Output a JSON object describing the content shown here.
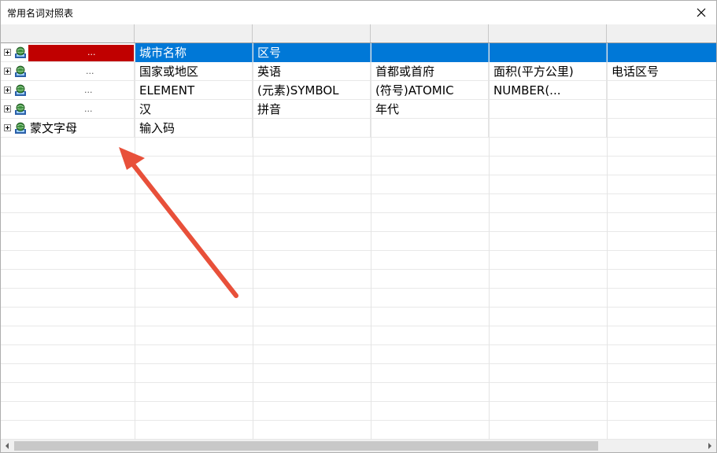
{
  "window": {
    "title": "常用名词对照表"
  },
  "columns": [
    "",
    "",
    "",
    "",
    "",
    "",
    ""
  ],
  "rows": [
    {
      "selected": true,
      "tree_label": "",
      "redacted": true,
      "ellipsis": "...",
      "cells": [
        "城市名称",
        "区号",
        "",
        "",
        ""
      ]
    },
    {
      "selected": false,
      "tree_label": "",
      "redacted": false,
      "ellipsis": "...",
      "cells": [
        "国家或地区",
        "英语",
        "首都或首府",
        "面积(平方公里)",
        "电话区号"
      ]
    },
    {
      "selected": false,
      "tree_label": "",
      "redacted": false,
      "ellipsis": "...",
      "cells": [
        "ELEMENT",
        "(元素)SYMBOL",
        "(符号)ATOMIC",
        "NUMBER(...",
        ""
      ]
    },
    {
      "selected": false,
      "tree_label": "",
      "redacted": false,
      "ellipsis": "...",
      "cells": [
        "汉",
        "拼音",
        "年代",
        "",
        ""
      ]
    },
    {
      "selected": false,
      "tree_label": "蒙文字母",
      "redacted": false,
      "ellipsis": "",
      "cells": [
        "输入码",
        "",
        "",
        "",
        ""
      ]
    }
  ],
  "colors": {
    "selection": "#0078d7",
    "redaction": "#c00000",
    "annotation_arrow": "#e8503a"
  },
  "icons": {
    "row_icon": "globe-computer-icon",
    "expander": "plus-expander-icon",
    "close": "close-icon"
  }
}
